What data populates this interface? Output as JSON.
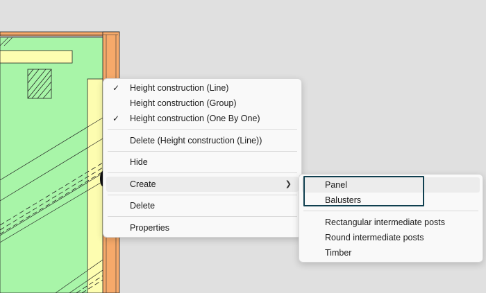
{
  "context_menu": {
    "items": [
      {
        "label": "Height construction (Line)",
        "checked": true
      },
      {
        "label": "Height construction (Group)",
        "checked": false
      },
      {
        "label": "Height construction (One By One)",
        "checked": true
      },
      {
        "label": "Delete (Height construction (Line))"
      },
      {
        "label": "Hide"
      },
      {
        "label": "Create",
        "has_submenu": true
      },
      {
        "label": "Delete"
      },
      {
        "label": "Properties"
      }
    ]
  },
  "submenu": {
    "items": [
      {
        "label": "Panel"
      },
      {
        "label": "Balusters"
      },
      {
        "label": "Rectangular intermediate posts"
      },
      {
        "label": "Round intermediate posts"
      },
      {
        "label": "Timber"
      }
    ]
  },
  "icons": {
    "check": "check-icon",
    "submenu_arrow": "chevron-right-icon"
  },
  "colors": {
    "floor_fill": "#a8f5a8",
    "wall_fill": "#f6a96a",
    "beam_fill": "#fdfdb0",
    "callout_border": "#0f3f4f"
  }
}
